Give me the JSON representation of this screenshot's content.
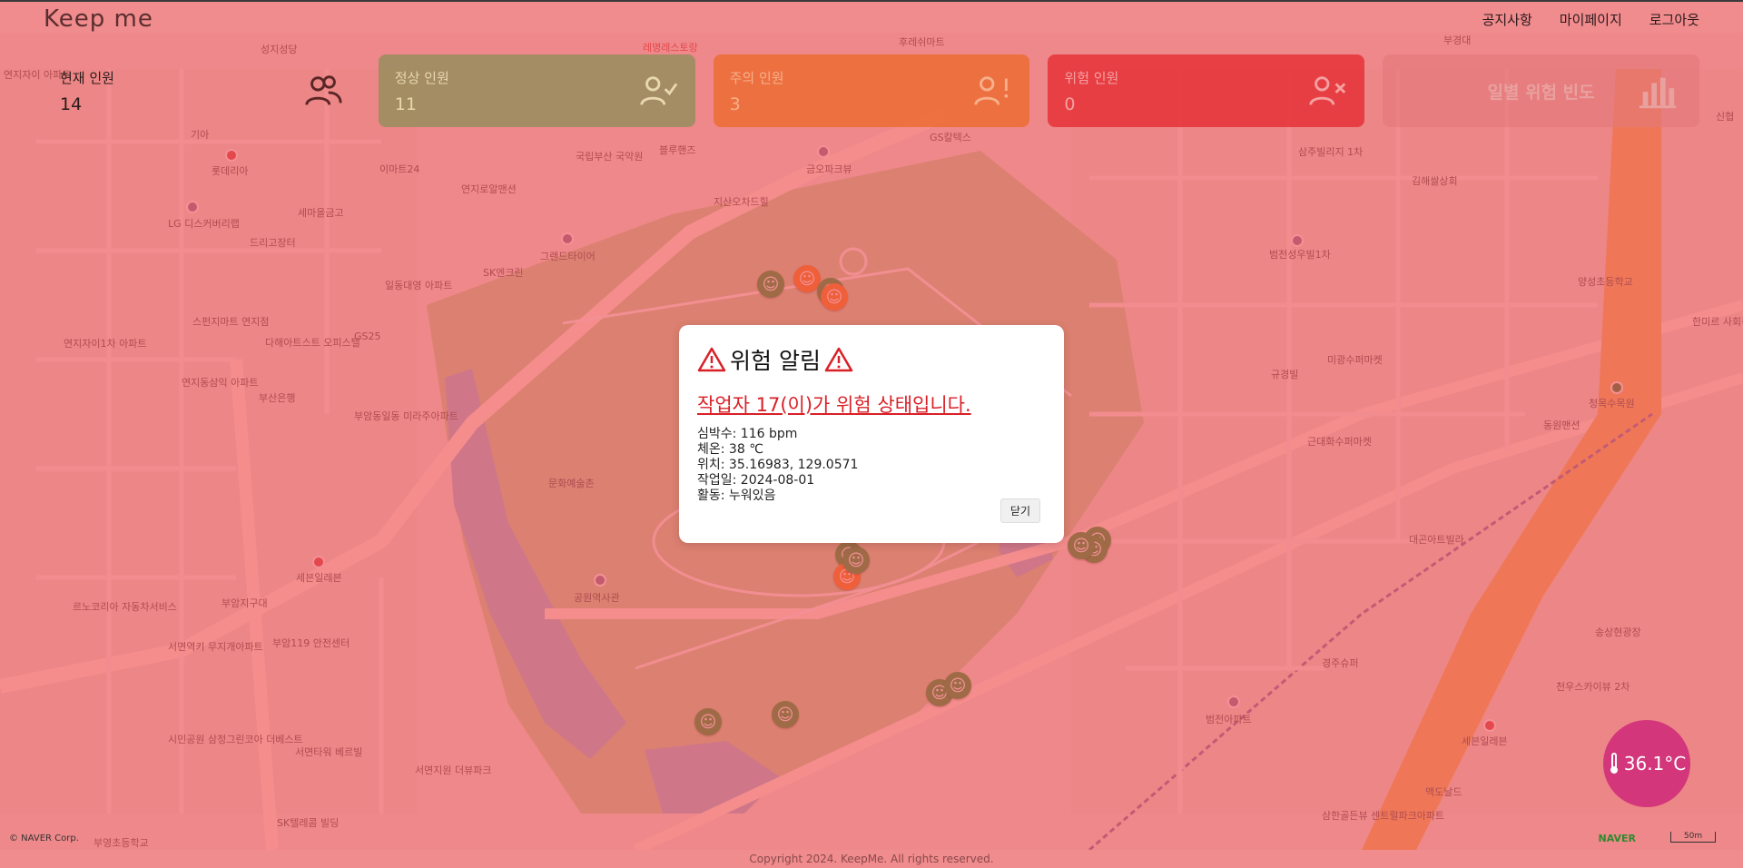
{
  "header": {
    "logo": "Keep me",
    "nav": [
      {
        "label": "공지사항"
      },
      {
        "label": "마이페이지"
      },
      {
        "label": "로그아웃"
      }
    ]
  },
  "cards": {
    "total": {
      "title": "현재 인원",
      "value": "14",
      "icon": "users-icon"
    },
    "normal": {
      "title": "정상 인원",
      "value": "11",
      "icon": "user-check-icon"
    },
    "caution": {
      "title": "주의 인원",
      "value": "3",
      "icon": "user-exclamation-icon"
    },
    "danger": {
      "title": "위험 인원",
      "value": "0",
      "icon": "user-x-icon"
    },
    "frequency": {
      "title": "일별 위험 빈도",
      "icon": "bar-chart-icon"
    }
  },
  "modal": {
    "title": "위험 알림",
    "headline": "작업자 17(이)가 위험 상태입니다.",
    "details": {
      "heart_rate": "심박수: 116 bpm",
      "temperature": "체온: 38 ℃",
      "location": "위치: 35.16983, 129.0571",
      "work_date": "작업일: 2024-08-01",
      "activity": "활동: 누워있음"
    },
    "close_label": "닫기"
  },
  "temperature_badge": {
    "value": "36.1°C",
    "icon": "thermometer-icon"
  },
  "footer": {
    "copyright": "Copyright 2024. KeepMe. All rights reserved."
  },
  "map": {
    "attribution": "© NAVER Corp.",
    "provider_logo": "NAVER",
    "scale": "50m",
    "labels": [
      "성지성당",
      "레명레스토랑",
      "후레쉬마트",
      "부경대",
      "연지자이 아파트",
      "기아",
      "롯데리아",
      "이마트24",
      "LG 디스커버리랩",
      "세마을금고",
      "드리고장터",
      "연지로알맨션",
      "그랜드타이어",
      "SK엔크린",
      "지산오차드힐",
      "금오파크뷰",
      "국립부산 국악원",
      "블루핸즈",
      "GS칼텍스",
      "삼주빌리지 1차",
      "김해쌀상회",
      "범전성우빌1차",
      "양성초등학교",
      "일동대영 아파트",
      "스펀지마트 연지점",
      "다해아트스트 오피스텔",
      "연지자이1차 아파트",
      "연지동삼익 아파트",
      "부산은행",
      "부암동일동 미라주아파트",
      "미광수퍼마켓",
      "규경빌",
      "청목수목원",
      "동원맨션",
      "근대화수퍼마켓",
      "문화예술촌",
      "대곤아트빌라",
      "세븐일레븐",
      "부암지구대",
      "르노코리아 자동차서비스",
      "서면역키 무지개아파트",
      "공원역사관",
      "부암119 안전센터",
      "시민공원 삼정그린코아 더베스트",
      "서면타워 베르빌",
      "서면지원 더뷰파크",
      "SK텔레콤 빌딩",
      "부영초등학교",
      "범전아파트",
      "경주슈퍼",
      "세븐일레븐",
      "천우스카이뷰 2차",
      "송상현광장",
      "삼한골든뷰 센트럴파크아파트",
      "맥도날드",
      "한미르 사회복지",
      "신협",
      "GS25"
    ],
    "workers": [
      {
        "status": "normal"
      },
      {
        "status": "caution"
      },
      {
        "status": "normal"
      },
      {
        "status": "caution"
      },
      {
        "status": "normal"
      },
      {
        "status": "normal"
      },
      {
        "status": "caution"
      },
      {
        "status": "normal"
      },
      {
        "status": "normal"
      },
      {
        "status": "normal"
      },
      {
        "status": "normal"
      },
      {
        "status": "normal"
      },
      {
        "status": "normal"
      },
      {
        "status": "normal"
      }
    ]
  },
  "colors": {
    "danger_overlay": "#ec404a",
    "normal": "#8b8e57",
    "caution": "#ec6c34",
    "danger": "#e6383e",
    "temperature": "#d4367c",
    "alert_text": "#d92027"
  }
}
